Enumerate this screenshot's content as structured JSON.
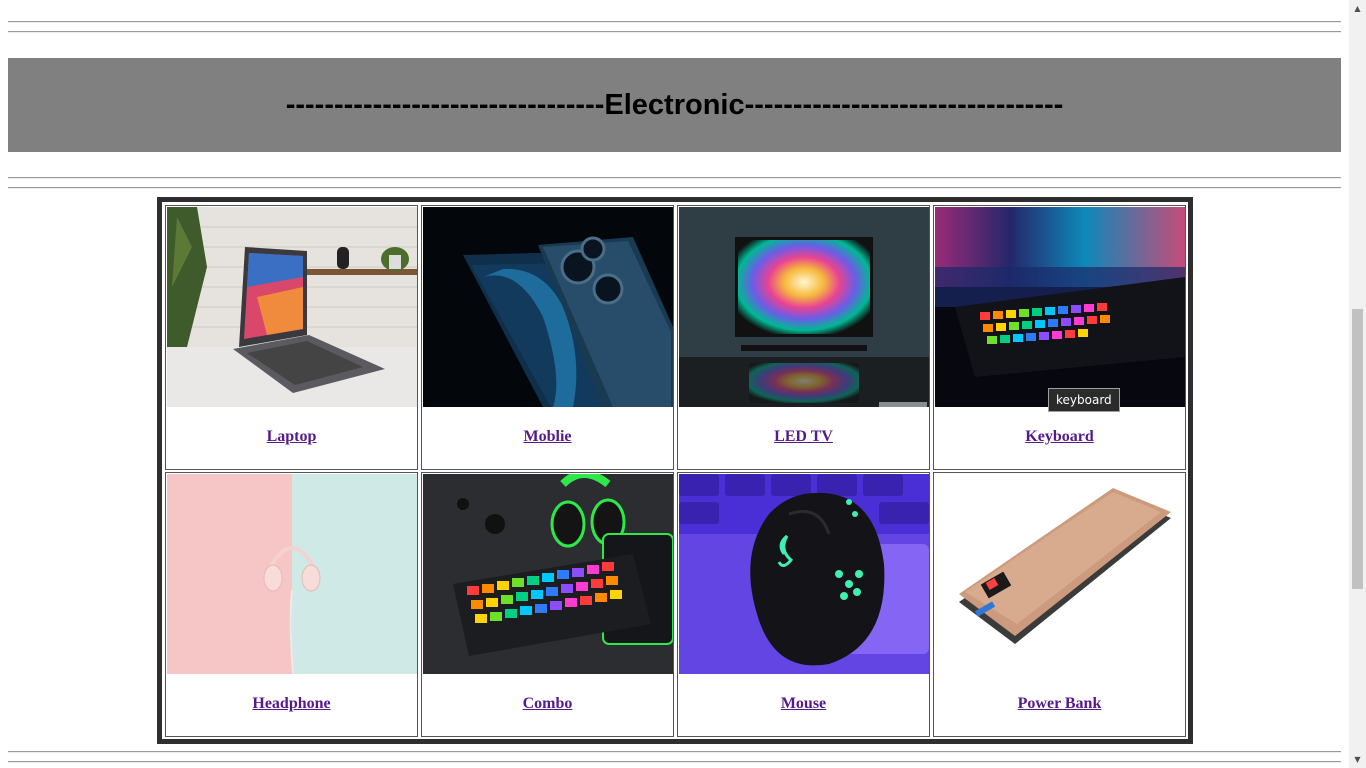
{
  "section": {
    "title": "---------------------------------Electronic---------------------------------"
  },
  "products": [
    {
      "label": "Laptop",
      "image": "laptop-image"
    },
    {
      "label": "Moblie",
      "image": "mobile-image"
    },
    {
      "label": "LED TV",
      "image": "led-tv-image"
    },
    {
      "label": "Keyboard",
      "image": "keyboard-image"
    },
    {
      "label": "Headphone",
      "image": "headphone-image"
    },
    {
      "label": "Combo",
      "image": "combo-image"
    },
    {
      "label": "Mouse",
      "image": "mouse-image"
    },
    {
      "label": "Power Bank",
      "image": "power-bank-image"
    }
  ],
  "tooltip": {
    "text": "keyboard"
  },
  "colors": {
    "banner": "#808080",
    "link": "#551a8b",
    "table_border": "#2e2e2e"
  },
  "scrollbar": {
    "up_icon": "scroll-up-arrow-icon",
    "down_icon": "scroll-down-arrow-icon"
  }
}
